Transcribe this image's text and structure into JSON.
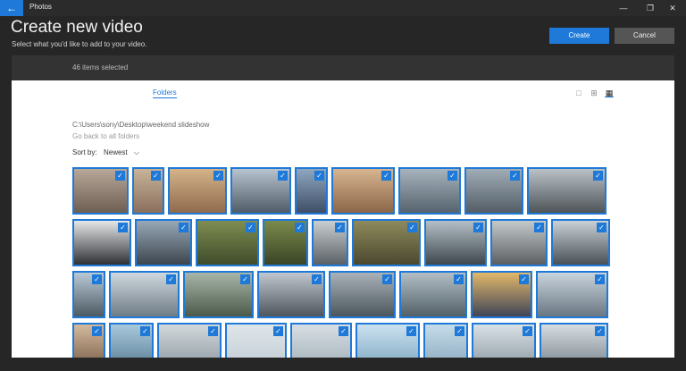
{
  "titlebar": {
    "back_glyph": "←",
    "app_title": "Photos",
    "min_glyph": "—",
    "max_glyph": "❐",
    "close_glyph": "✕"
  },
  "header": {
    "title": "Create new video",
    "subtitle": "Select what you'd like to add to your video.",
    "create_label": "Create",
    "cancel_label": "Cancel"
  },
  "selection": {
    "count_text": "46 items selected"
  },
  "tabs": {
    "folders_label": "Folders"
  },
  "view_icons": {
    "single": "□",
    "medium": "⊞",
    "small": "▦"
  },
  "folder": {
    "path": "C:\\Users\\sony\\Desktop\\weekend slideshow",
    "back_link": "Go back to all folders"
  },
  "sort": {
    "label": "Sort by:",
    "value": "Newest",
    "chevron": "⌵"
  },
  "colors": {
    "accent": "#1e79d8",
    "check": "✓"
  },
  "rows": [
    [
      {
        "w": 63,
        "c1": "#b8a89a",
        "c2": "#6d5e52"
      },
      {
        "w": 36,
        "c1": "#c7b39a",
        "c2": "#8a6f5c"
      },
      {
        "w": 66,
        "c1": "#d4b38a",
        "c2": "#8f6a4d"
      },
      {
        "w": 68,
        "c1": "#b7c4cf",
        "c2": "#4f5b66"
      },
      {
        "w": 37,
        "c1": "#8fa6c0",
        "c2": "#3e4e66"
      },
      {
        "w": 71,
        "c1": "#d7b590",
        "c2": "#8b6548"
      },
      {
        "w": 70,
        "c1": "#a7b3bd",
        "c2": "#55636e"
      },
      {
        "w": 66,
        "c1": "#a1adb6",
        "c2": "#525d66"
      },
      {
        "w": 89,
        "c1": "#b9c1c7",
        "c2": "#4e5458"
      }
    ],
    [
      {
        "w": 66,
        "c1": "#e6e7e9",
        "c2": "#2f3134"
      },
      {
        "w": 64,
        "c1": "#98a8b6",
        "c2": "#3d4650"
      },
      {
        "w": 71,
        "c1": "#7f8d52",
        "c2": "#3f4c2a"
      },
      {
        "w": 51,
        "c1": "#7b8a4c",
        "c2": "#3a4526"
      },
      {
        "w": 41,
        "c1": "#c9ced1",
        "c2": "#5a6166"
      },
      {
        "w": 77,
        "c1": "#8e8a5d",
        "c2": "#4b482f"
      },
      {
        "w": 70,
        "c1": "#b4bfc7",
        "c2": "#3e474d"
      },
      {
        "w": 64,
        "c1": "#c4c9cc",
        "c2": "#5b5f61"
      },
      {
        "w": 66,
        "c1": "#c9d1d6",
        "c2": "#4a5156"
      }
    ],
    [
      {
        "w": 37,
        "c1": "#b8c9d6",
        "c2": "#4d5a63"
      },
      {
        "w": 79,
        "c1": "#cfd8de",
        "c2": "#6f7c86"
      },
      {
        "w": 79,
        "c1": "#a8b6a9",
        "c2": "#4b5a4a"
      },
      {
        "w": 76,
        "c1": "#c0c7ce",
        "c2": "#4e555c"
      },
      {
        "w": 75,
        "c1": "#a8b2b8",
        "c2": "#4c565d"
      },
      {
        "w": 76,
        "c1": "#b3bfc5",
        "c2": "#526068"
      },
      {
        "w": 69,
        "c1": "#e2b86a",
        "c2": "#3f4458"
      },
      {
        "w": 81,
        "c1": "#c9d4dc",
        "c2": "#6a7783"
      }
    ],
    [
      {
        "w": 37,
        "c1": "#d3b99e",
        "c2": "#7a5e48"
      },
      {
        "w": 50,
        "c1": "#a9c8dc",
        "c2": "#5b7f96"
      },
      {
        "w": 72,
        "c1": "#d2d8dc",
        "c2": "#8f9aa1"
      },
      {
        "w": 69,
        "c1": "#dfe6ea",
        "c2": "#c1ccd3"
      },
      {
        "w": 69,
        "c1": "#d8dfe4",
        "c2": "#a3b0b9"
      },
      {
        "w": 72,
        "c1": "#cbe2f0",
        "c2": "#7fa7c0"
      },
      {
        "w": 50,
        "c1": "#c6dcea",
        "c2": "#8aa9bd"
      },
      {
        "w": 72,
        "c1": "#d9e1e6",
        "c2": "#8d9aa3"
      },
      {
        "w": 77,
        "c1": "#d7dde1",
        "c2": "#7b868d"
      }
    ]
  ]
}
